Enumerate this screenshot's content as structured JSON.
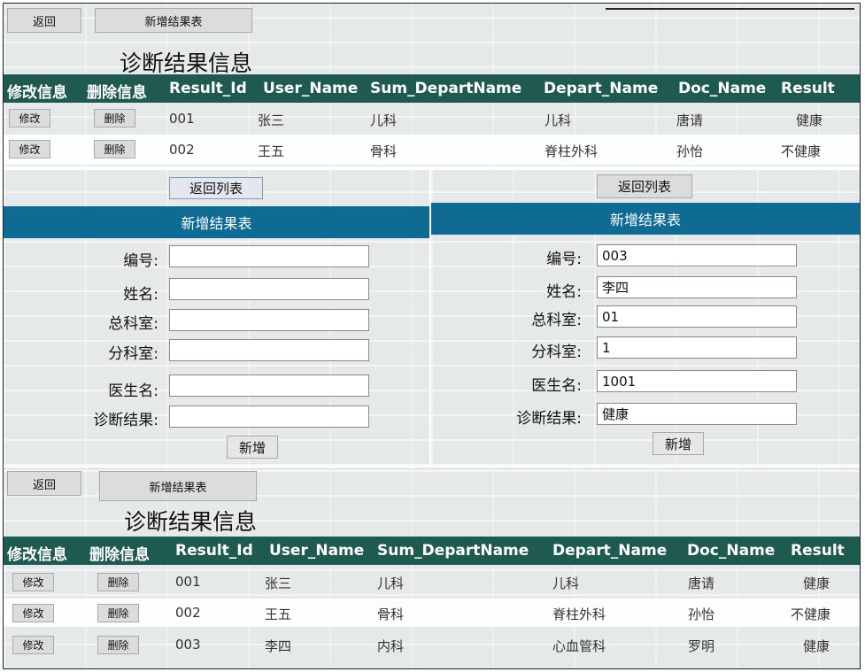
{
  "top": {
    "back_label": "返回",
    "add_label": "新增结果表",
    "title": "诊断结果信息",
    "headers": [
      "修改信息",
      "删除信息",
      "Result_Id",
      "User_Name",
      "Sum_DepartName",
      "Depart_Name",
      "Doc_Name",
      "Result"
    ],
    "edit_label": "修改",
    "delete_label": "删除",
    "rows": [
      {
        "id": "001",
        "name": "张三",
        "sum": "儿科",
        "dep": "儿科",
        "doc": "唐请",
        "res": "健康"
      },
      {
        "id": "002",
        "name": "王五",
        "sum": "骨科",
        "dep": "脊柱外科",
        "doc": "孙怡",
        "res": "不健康"
      }
    ]
  },
  "form_empty": {
    "back_label": "返回列表",
    "header": "新增结果表",
    "labels": [
      "编号:",
      "姓名:",
      "总科室:",
      "分科室:",
      "医生名:",
      "诊断结果:"
    ],
    "values": [
      "",
      "",
      "",
      "",
      "",
      ""
    ],
    "submit_label": "新增"
  },
  "form_filled": {
    "back_label": "返回列表",
    "header": "新增结果表",
    "labels": [
      "编号:",
      "姓名:",
      "总科室:",
      "分科室:",
      "医生名:",
      "诊断结果:"
    ],
    "values": [
      "003",
      "李四",
      "01",
      "1",
      "1001",
      "健康"
    ],
    "submit_label": "新增"
  },
  "bottom": {
    "back_label": "返回",
    "add_label": "新增结果表",
    "title": "诊断结果信息",
    "headers": [
      "修改信息",
      "删除信息",
      "Result_Id",
      "User_Name",
      "Sum_DepartName",
      "Depart_Name",
      "Doc_Name",
      "Result"
    ],
    "edit_label": "修改",
    "delete_label": "删除",
    "rows": [
      {
        "id": "001",
        "name": "张三",
        "sum": "儿科",
        "dep": "儿科",
        "doc": "唐请",
        "res": "健康"
      },
      {
        "id": "002",
        "name": "王五",
        "sum": "骨科",
        "dep": "脊柱外科",
        "doc": "孙怡",
        "res": "不健康"
      },
      {
        "id": "003",
        "name": "李四",
        "sum": "内科",
        "dep": "心血管科",
        "doc": "罗明",
        "res": "健康"
      }
    ]
  },
  "colors": {
    "table_header": "#1e5a50",
    "form_header": "#0f6b94"
  }
}
